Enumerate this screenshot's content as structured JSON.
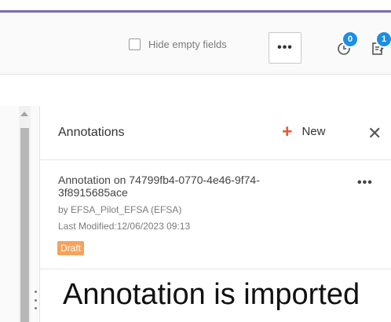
{
  "toolbar": {
    "hide_empty_label": "Hide empty fields",
    "more_label": "•••",
    "history_badge": "0",
    "notes_badge": "1"
  },
  "panel": {
    "title": "Annotations",
    "new_label": "New",
    "close_label": "✕"
  },
  "annotation": {
    "title": "Annotation on 74799fb4-0770-4e46-9f74-3f8915685ace",
    "more_label": "•••",
    "author": "by EFSA_Pilot_EFSA (EFSA)",
    "last_modified": "Last Modified:12/06/2023 09:13",
    "status": "Draft"
  },
  "caption": "Annotation is imported",
  "colors": {
    "accent_bar": "#7b6bb5",
    "badge_blue": "#1d8ee6",
    "new_plus": "#e8592e",
    "draft_badge": "#f5a25b"
  },
  "icons": [
    "history-icon",
    "notes-icon",
    "plus-icon",
    "close-icon",
    "more-icon",
    "drag-handle-icon"
  ]
}
